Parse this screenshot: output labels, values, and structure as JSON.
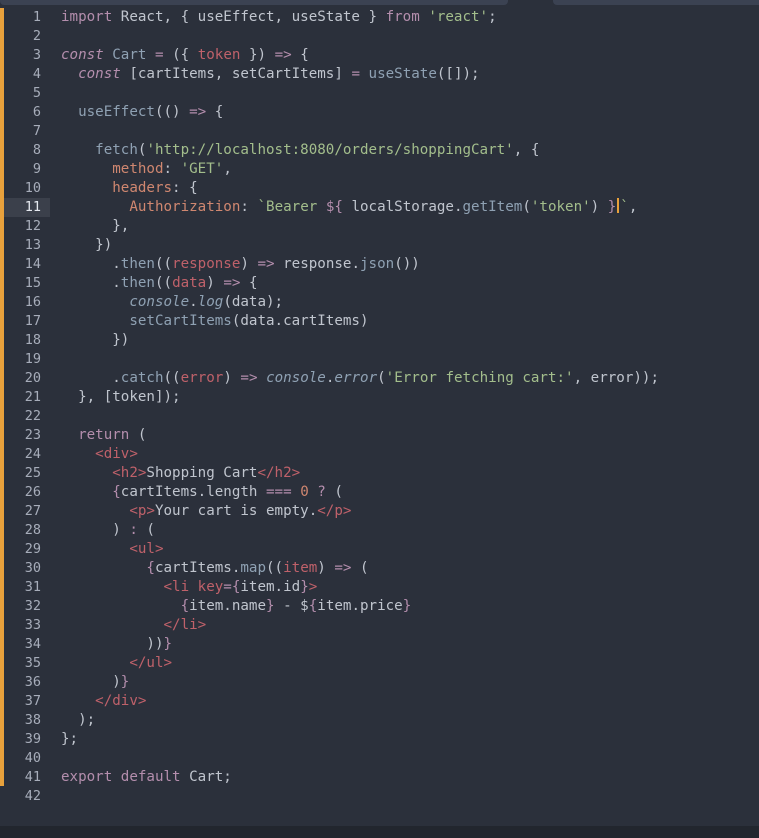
{
  "editor": {
    "current_line": 11,
    "lines": [
      [
        [
          "k",
          "import"
        ],
        [
          "v",
          " React, { useEffect, useState } "
        ],
        [
          "k",
          "from"
        ],
        [
          "v",
          " "
        ],
        [
          "s",
          "'react'"
        ],
        [
          "v",
          ";"
        ]
      ],
      [],
      [
        [
          "ki",
          "const"
        ],
        [
          "v",
          " "
        ],
        [
          "f",
          "Cart"
        ],
        [
          "v",
          " "
        ],
        [
          "k",
          "="
        ],
        [
          "v",
          " ({ "
        ],
        [
          "d",
          "token"
        ],
        [
          "v",
          " }) "
        ],
        [
          "k",
          "=>"
        ],
        [
          "v",
          " {"
        ]
      ],
      [
        [
          "v",
          "  "
        ],
        [
          "ki",
          "const"
        ],
        [
          "v",
          " [cartItems, setCartItems] "
        ],
        [
          "k",
          "="
        ],
        [
          "v",
          " "
        ],
        [
          "f",
          "useState"
        ],
        [
          "v",
          "([]);"
        ]
      ],
      [],
      [
        [
          "v",
          "  "
        ],
        [
          "f",
          "useEffect"
        ],
        [
          "v",
          "(() "
        ],
        [
          "k",
          "=>"
        ],
        [
          "v",
          " {"
        ]
      ],
      [],
      [
        [
          "v",
          "    "
        ],
        [
          "f",
          "fetch"
        ],
        [
          "v",
          "("
        ],
        [
          "s",
          "'http://localhost:8080/orders/shoppingCart'"
        ],
        [
          "v",
          ", {"
        ]
      ],
      [
        [
          "v",
          "      "
        ],
        [
          "prop",
          "method"
        ],
        [
          "v",
          ": "
        ],
        [
          "s",
          "'GET'"
        ],
        [
          "v",
          ","
        ]
      ],
      [
        [
          "v",
          "      "
        ],
        [
          "prop",
          "headers"
        ],
        [
          "v",
          ": {"
        ]
      ],
      [
        [
          "v",
          "        "
        ],
        [
          "prop",
          "Authorization"
        ],
        [
          "v",
          ": "
        ],
        [
          "s",
          "`Bearer "
        ],
        [
          "k",
          "${"
        ],
        [
          "v",
          " localStorage."
        ],
        [
          "f",
          "getItem"
        ],
        [
          "v",
          "("
        ],
        [
          "s",
          "'token'"
        ],
        [
          "v",
          ") "
        ],
        [
          "k",
          "}"
        ],
        [
          "caret",
          ""
        ],
        [
          "s",
          "`"
        ],
        [
          "v",
          ","
        ]
      ],
      [
        [
          "v",
          "      },"
        ]
      ],
      [
        [
          "v",
          "    })"
        ]
      ],
      [
        [
          "v",
          "      ."
        ],
        [
          "f",
          "then"
        ],
        [
          "v",
          "(("
        ],
        [
          "d",
          "response"
        ],
        [
          "v",
          ") "
        ],
        [
          "k",
          "=>"
        ],
        [
          "v",
          " response."
        ],
        [
          "f",
          "json"
        ],
        [
          "v",
          "())"
        ]
      ],
      [
        [
          "v",
          "      ."
        ],
        [
          "f",
          "then"
        ],
        [
          "v",
          "(("
        ],
        [
          "d",
          "data"
        ],
        [
          "v",
          ") "
        ],
        [
          "k",
          "=>"
        ],
        [
          "v",
          " {"
        ]
      ],
      [
        [
          "v",
          "        "
        ],
        [
          "c",
          "console"
        ],
        [
          "v",
          "."
        ],
        [
          "c",
          "log"
        ],
        [
          "v",
          "(data);"
        ]
      ],
      [
        [
          "v",
          "        "
        ],
        [
          "f",
          "setCartItems"
        ],
        [
          "v",
          "(data.cartItems)"
        ]
      ],
      [
        [
          "v",
          "      })"
        ]
      ],
      [],
      [
        [
          "v",
          "      ."
        ],
        [
          "f",
          "catch"
        ],
        [
          "v",
          "(("
        ],
        [
          "d",
          "error"
        ],
        [
          "v",
          ") "
        ],
        [
          "k",
          "=>"
        ],
        [
          "v",
          " "
        ],
        [
          "c",
          "console"
        ],
        [
          "v",
          "."
        ],
        [
          "c",
          "error"
        ],
        [
          "v",
          "("
        ],
        [
          "s",
          "'Error fetching cart:'"
        ],
        [
          "v",
          ", error));"
        ]
      ],
      [
        [
          "v",
          "  }, [token]);"
        ]
      ],
      [],
      [
        [
          "v",
          "  "
        ],
        [
          "k",
          "return"
        ],
        [
          "v",
          " ("
        ]
      ],
      [
        [
          "v",
          "    "
        ],
        [
          "t",
          "<div>"
        ]
      ],
      [
        [
          "v",
          "      "
        ],
        [
          "t",
          "<h2>"
        ],
        [
          "v",
          "Shopping Cart"
        ],
        [
          "t",
          "</h2>"
        ]
      ],
      [
        [
          "v",
          "      "
        ],
        [
          "k",
          "{"
        ],
        [
          "v",
          "cartItems.length "
        ],
        [
          "k",
          "==="
        ],
        [
          "v",
          " "
        ],
        [
          "n",
          "0"
        ],
        [
          "v",
          " "
        ],
        [
          "k",
          "?"
        ],
        [
          "v",
          " ("
        ]
      ],
      [
        [
          "v",
          "        "
        ],
        [
          "t",
          "<p>"
        ],
        [
          "v",
          "Your cart is empty."
        ],
        [
          "t",
          "</p>"
        ]
      ],
      [
        [
          "v",
          "      ) "
        ],
        [
          "k",
          ":"
        ],
        [
          "v",
          " ("
        ]
      ],
      [
        [
          "v",
          "        "
        ],
        [
          "t",
          "<ul>"
        ]
      ],
      [
        [
          "v",
          "          "
        ],
        [
          "k",
          "{"
        ],
        [
          "v",
          "cartItems."
        ],
        [
          "f",
          "map"
        ],
        [
          "v",
          "(("
        ],
        [
          "d",
          "item"
        ],
        [
          "v",
          ") "
        ],
        [
          "k",
          "=>"
        ],
        [
          "v",
          " ("
        ]
      ],
      [
        [
          "v",
          "            "
        ],
        [
          "t",
          "<li"
        ],
        [
          "v",
          " "
        ],
        [
          "d",
          "key"
        ],
        [
          "k",
          "="
        ],
        [
          "k",
          "{"
        ],
        [
          "v",
          "item.id"
        ],
        [
          "k",
          "}"
        ],
        [
          "t",
          ">"
        ]
      ],
      [
        [
          "v",
          "              "
        ],
        [
          "k",
          "{"
        ],
        [
          "v",
          "item.name"
        ],
        [
          "k",
          "}"
        ],
        [
          "v",
          " - $"
        ],
        [
          "k",
          "{"
        ],
        [
          "v",
          "item.price"
        ],
        [
          "k",
          "}"
        ]
      ],
      [
        [
          "v",
          "            "
        ],
        [
          "t",
          "</li>"
        ]
      ],
      [
        [
          "v",
          "          ))"
        ],
        [
          "k",
          "}"
        ]
      ],
      [
        [
          "v",
          "        "
        ],
        [
          "t",
          "</ul>"
        ]
      ],
      [
        [
          "v",
          "      )"
        ],
        [
          "k",
          "}"
        ]
      ],
      [
        [
          "v",
          "    "
        ],
        [
          "t",
          "</div>"
        ]
      ],
      [
        [
          "v",
          "  );"
        ]
      ],
      [
        [
          "v",
          "};"
        ]
      ],
      [],
      [
        [
          "k",
          "export"
        ],
        [
          "v",
          " "
        ],
        [
          "k",
          "default"
        ],
        [
          "v",
          " Cart;"
        ]
      ],
      []
    ]
  }
}
